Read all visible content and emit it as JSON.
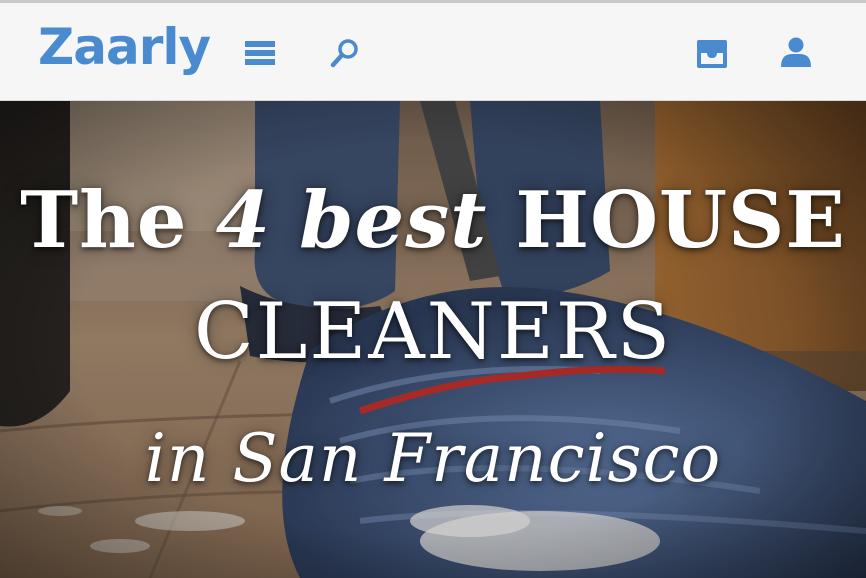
{
  "header": {
    "logo_text": "Zaarly",
    "icons": {
      "menu": "menu-icon",
      "search": "search-icon",
      "inbox": "inbox-icon",
      "user": "user-icon"
    },
    "accent_color": "#4a8bd0"
  },
  "hero": {
    "headline_part1": "The ",
    "headline_emphasis": "4 best",
    "headline_part2": " HOUSE",
    "headline_line2": "CLEANERS",
    "headline_line3": "in San Francisco",
    "background_image": "mop-cleaning-floor-photo"
  }
}
